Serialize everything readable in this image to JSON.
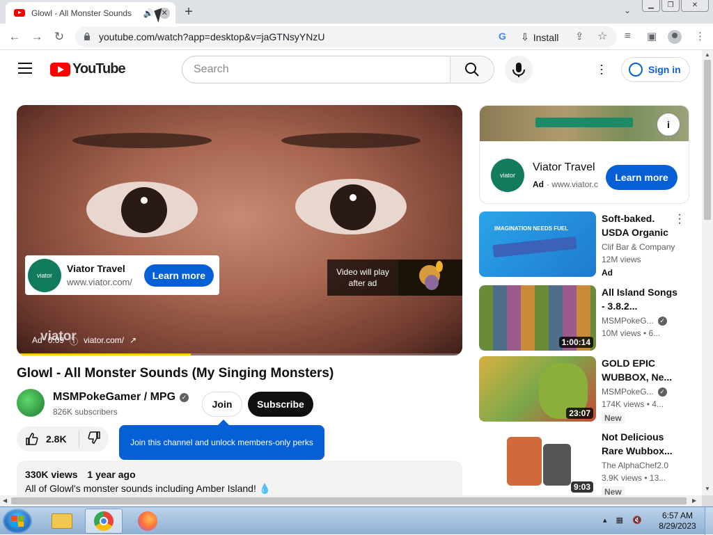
{
  "browser": {
    "tab_title": "Glowl - All Monster Sounds (My Singing Monsters) - YouTube",
    "tab_audio_icon": "speaker-icon",
    "url": "youtube.com/watch?app=desktop&v=jaGTNsyYNzU",
    "install_label": "Install",
    "window_buttons": [
      "minimize",
      "restore",
      "close"
    ]
  },
  "masthead": {
    "logo_text": "YouTube",
    "search_placeholder": "Search",
    "signin_label": "Sign in"
  },
  "player": {
    "ad_card": {
      "logo_text": "viator",
      "name": "Viator Travel",
      "domain": "www.viator.com/",
      "cta": "Learn more"
    },
    "video_will_play": "Video will play after ad",
    "watermark": "viator",
    "ad_label": "Ad",
    "ad_time": "0:09",
    "ad_domain": "viator.com/",
    "progress_fraction": 0.39
  },
  "video": {
    "title": "Glowl - All Monster Sounds (My Singing Monsters)",
    "channel_name": "MSMPokeGamer / MPG",
    "subscribers": "826K subscribers",
    "join_label": "Join",
    "subscribe_label": "Subscribe",
    "likes": "2.8K",
    "tooltip": "Join this channel and unlock members-only perks",
    "views": "330K views",
    "age": "1 year ago",
    "description_line": "All of Glowl's monster sounds including Amber Island! 💧"
  },
  "side_ad": {
    "logo_text": "viator",
    "name": "Viator Travel",
    "ad_label": "Ad",
    "domain": "· www.viator.com",
    "cta": "Learn more",
    "info_icon": "i"
  },
  "recommendations": [
    {
      "title": "Soft-baked. USDA Organic",
      "channel": "Clif Bar & Company",
      "views": "12M views",
      "tag": "Ad",
      "duration": "",
      "verified": false
    },
    {
      "title": "All Island Songs - 3.8.2...",
      "channel": "MSMPokeG...",
      "views": "10M views  •  6...",
      "tag": "",
      "duration": "1:00:14",
      "verified": true
    },
    {
      "title": "GOLD EPIC WUBBOX, Ne...",
      "channel": "MSMPokeG...",
      "views": "174K views  •  4...",
      "tag": "New",
      "duration": "23:07",
      "verified": true
    },
    {
      "title": "Not Delicious Rare Wubbox...",
      "channel": "The AlphaChef2.0",
      "views": "3.9K views  •  13...",
      "tag": "New",
      "duration": "9:03",
      "verified": false
    }
  ],
  "taskbar": {
    "time": "6:57 AM",
    "date": "8/29/2023"
  }
}
